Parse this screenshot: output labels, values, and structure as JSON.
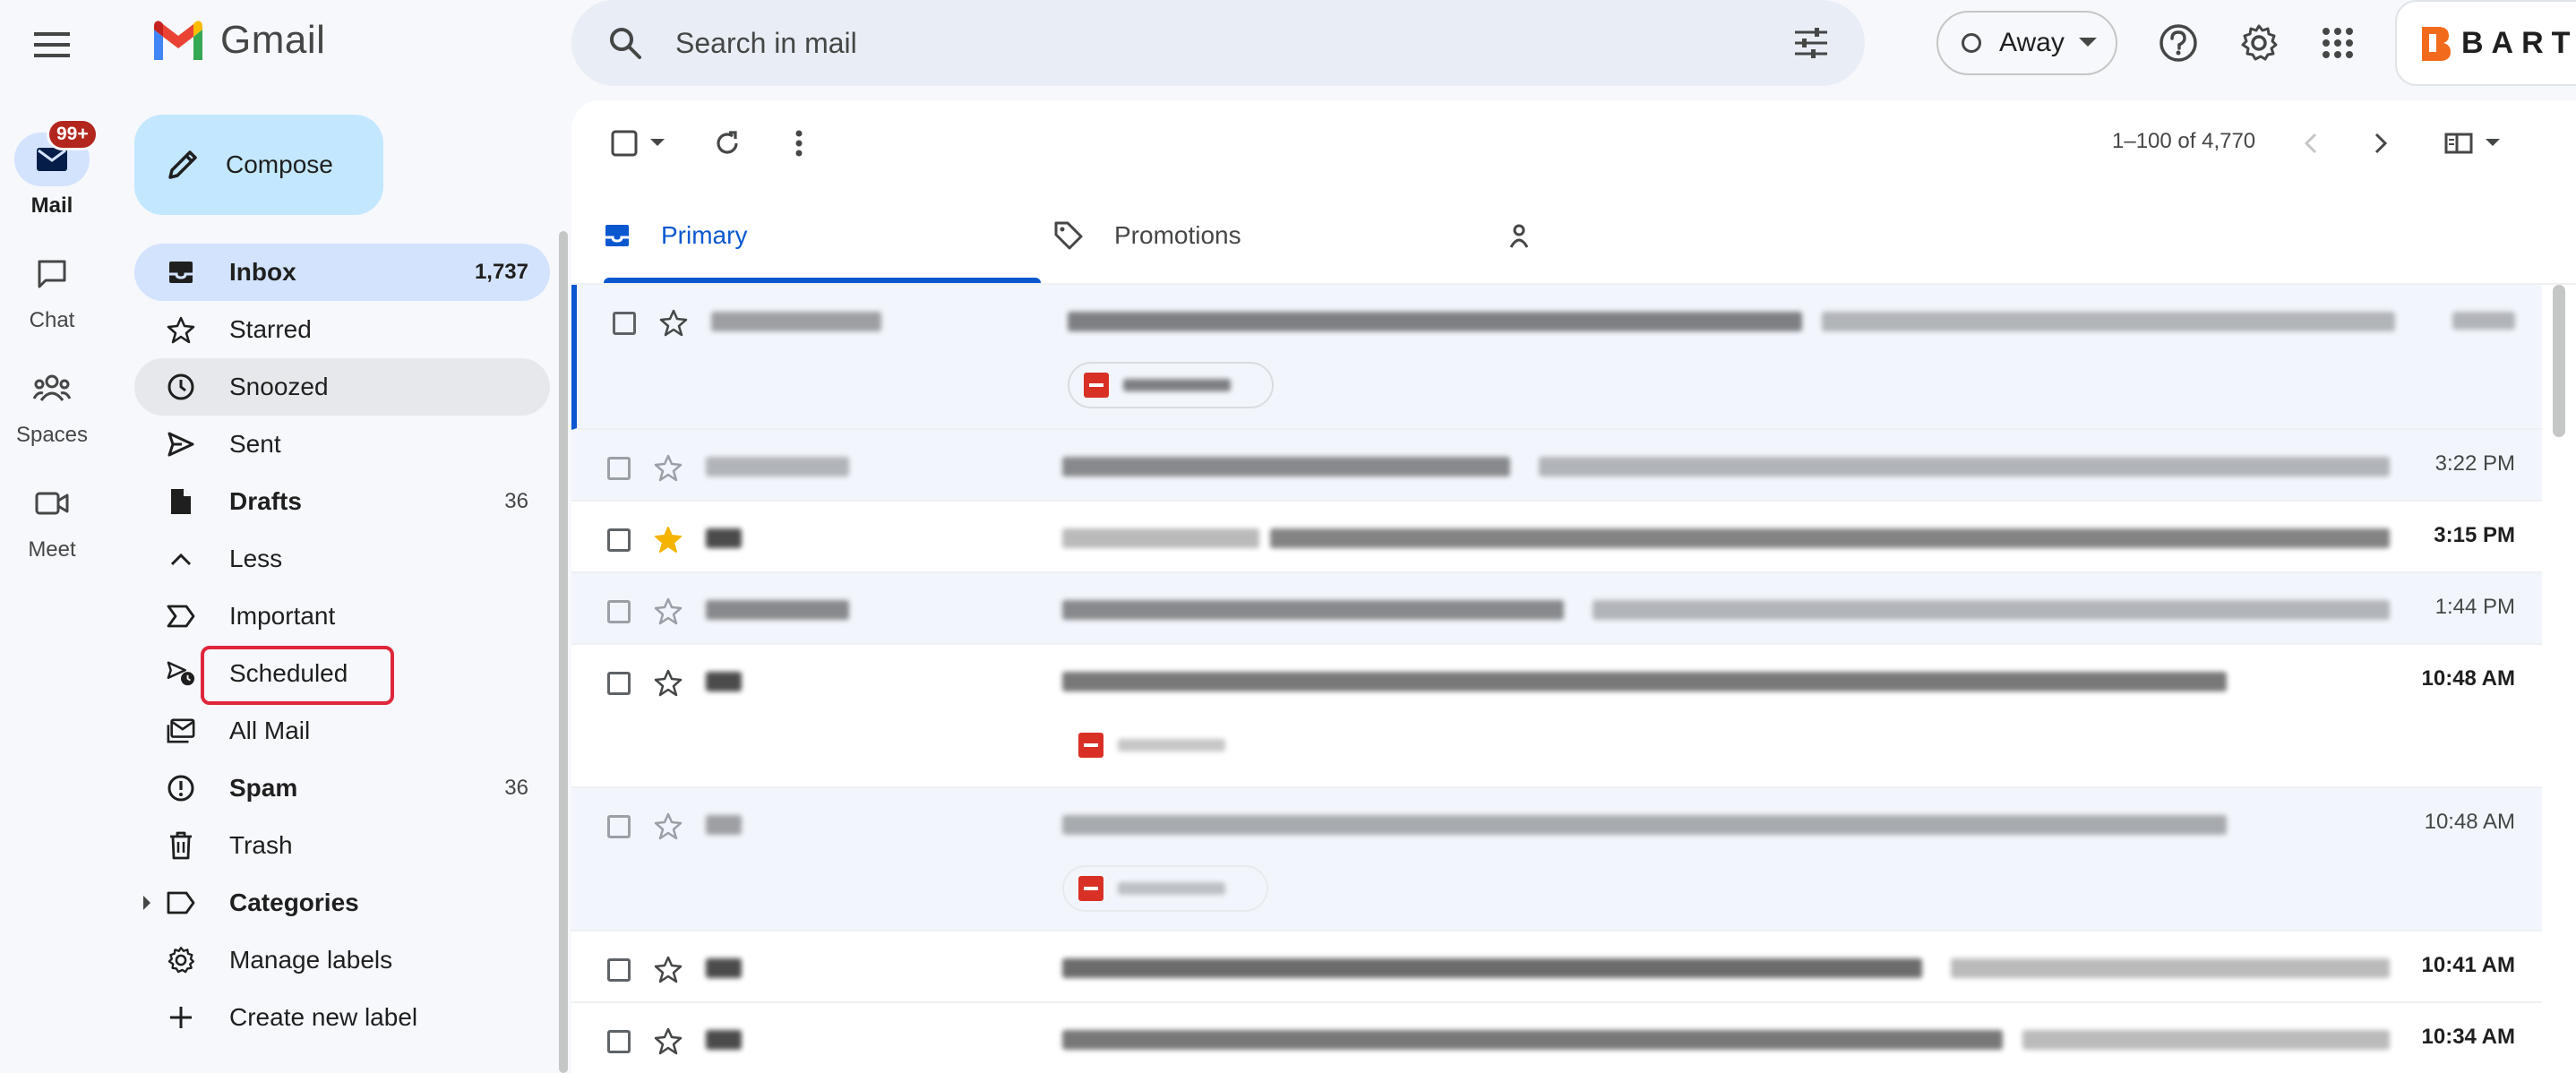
{
  "app": {
    "name": "Gmail"
  },
  "rail": {
    "items": [
      {
        "label": "Mail",
        "badge": "99+"
      },
      {
        "label": "Chat"
      },
      {
        "label": "Spaces"
      },
      {
        "label": "Meet"
      }
    ]
  },
  "search": {
    "placeholder": "Search in mail"
  },
  "status": {
    "label": "Away"
  },
  "account": {
    "label": "BART"
  },
  "compose": {
    "label": "Compose"
  },
  "nav": {
    "items": [
      {
        "label": "Inbox",
        "count": "1,737"
      },
      {
        "label": "Starred"
      },
      {
        "label": "Snoozed"
      },
      {
        "label": "Sent"
      },
      {
        "label": "Drafts",
        "count": "36"
      },
      {
        "label": "Less"
      },
      {
        "label": "Important"
      },
      {
        "label": "Scheduled"
      },
      {
        "label": "All Mail"
      },
      {
        "label": "Spam",
        "count": "36"
      },
      {
        "label": "Trash"
      },
      {
        "label": "Categories"
      },
      {
        "label": "Manage labels"
      },
      {
        "label": "Create new label"
      }
    ]
  },
  "toolbar": {
    "pagination": "1–100 of 4,770"
  },
  "tabs": [
    {
      "label": "Primary"
    },
    {
      "label": "Promotions"
    }
  ],
  "emails": [
    {
      "time": ""
    },
    {
      "time": "3:22 PM"
    },
    {
      "time": "3:15 PM"
    },
    {
      "time": "1:44 PM"
    },
    {
      "time": "10:48 AM"
    },
    {
      "time": "10:48 AM"
    },
    {
      "time": "10:41 AM"
    },
    {
      "time": "10:34 AM"
    }
  ],
  "colors": {
    "accent": "#0b57d0",
    "compose_bg": "#c2e7ff",
    "selected_nav_bg": "#d3e3fd",
    "highlight_box": "#e0263a",
    "star_active": "#f4b400"
  }
}
